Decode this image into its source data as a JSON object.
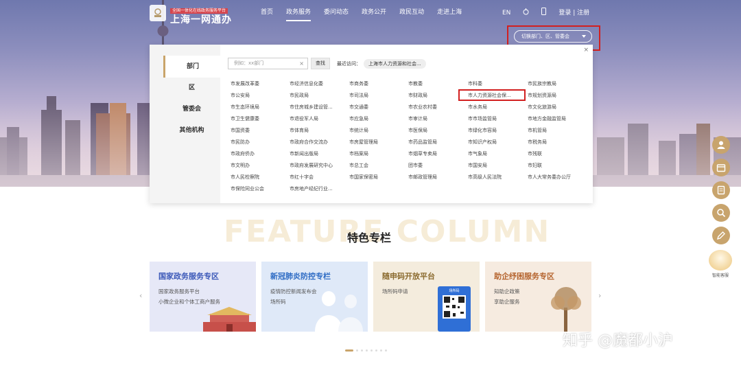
{
  "header": {
    "logo_sub": "全国一体化在线政务服务平台",
    "logo_main": "上海一网通办",
    "nav": [
      "首页",
      "政务服务",
      "委问动态",
      "政务公开",
      "政民互动",
      "走进上海"
    ],
    "nav_active_index": 1,
    "lang": "EN",
    "auth": "登录 | 注册"
  },
  "region_selector": {
    "label": "切换部门、区、管委会"
  },
  "panel": {
    "close": "×",
    "tabs": [
      "部门",
      "区",
      "管委会",
      "其他机构"
    ],
    "active_tab_index": 0,
    "search_placeholder": "例如：xx部门",
    "search_clear": "×",
    "search_button": "查找",
    "recent_label": "最近访问：",
    "recent_item": "上海市人力资源和社会...",
    "departments": [
      [
        "市发展改革委",
        "市经济信息化委",
        "市商务委",
        "市教委",
        "市科委",
        "市民族宗教局"
      ],
      [
        "市公安局",
        "市民政局",
        "市司法局",
        "市财政局",
        "市人力资源社会保...",
        "市规划资源局"
      ],
      [
        "市生态环境局",
        "市住房城乡建设管...",
        "市交通委",
        "市农业农村委",
        "市水务局",
        "市文化旅游局"
      ],
      [
        "市卫生健康委",
        "市退役军人局",
        "市应急局",
        "市审计局",
        "市市场监管局",
        "市地方金融监管局"
      ],
      [
        "市国资委",
        "市体育局",
        "市统计局",
        "市医保局",
        "市绿化市容局",
        "市机管局"
      ],
      [
        "市民防办",
        "市政府合作交流办",
        "市房屋管理局",
        "市药品监管局",
        "市知识产权局",
        "市税务局"
      ],
      [
        "市政府侨办",
        "市新闻出版局",
        "市档案局",
        "市烟草专卖局",
        "市气象局",
        "市残联"
      ],
      [
        "市文明办",
        "市政府发展研究中心",
        "市总工会",
        "团市委",
        "市国安局",
        "市妇联"
      ],
      [
        "市人民检察院",
        "市红十字会",
        "市国家保密局",
        "市邮政管理局",
        "市高级人民法院",
        "市人大常务委办公厅"
      ],
      [
        "市保险同业公会",
        "市房地产经纪行业..."
      ]
    ],
    "highlighted": "市人力资源社会保..."
  },
  "floating_toolbar": {
    "buttons": [
      "user-icon",
      "calendar-icon",
      "document-icon",
      "search-icon",
      "edit-icon"
    ],
    "robot_label": "智能客服"
  },
  "feature": {
    "bg_text": "FEATURE COLUMN",
    "title": "特色专栏",
    "prev": "‹",
    "next": "›",
    "cards": [
      {
        "title": "国家政务服务专区",
        "lines": [
          "国家政务服务平台",
          "小微企业和个体工商户服务"
        ],
        "bg": "#e6e8f7",
        "color": "#3b58b8"
      },
      {
        "title": "新冠肺炎防控专栏",
        "lines": [
          "疫情防控新闻发布会",
          "场所码"
        ],
        "bg": "#dfe9f8",
        "color": "#2d6bc4"
      },
      {
        "title": "随申码开放平台",
        "lines": [
          "场所码申请"
        ],
        "bg": "#f4ecdd",
        "color": "#8a6a2e"
      },
      {
        "title": "助企纾困服务专区",
        "lines": [
          "知助企政策",
          "享助企服务"
        ],
        "bg": "#f6ebe0",
        "color": "#b5642e"
      }
    ],
    "qr_label": "场所码"
  },
  "watermark": "知乎 @魔都小沪",
  "colors": {
    "accent": "#c9a46a",
    "highlight_border": "#d21f1f"
  }
}
